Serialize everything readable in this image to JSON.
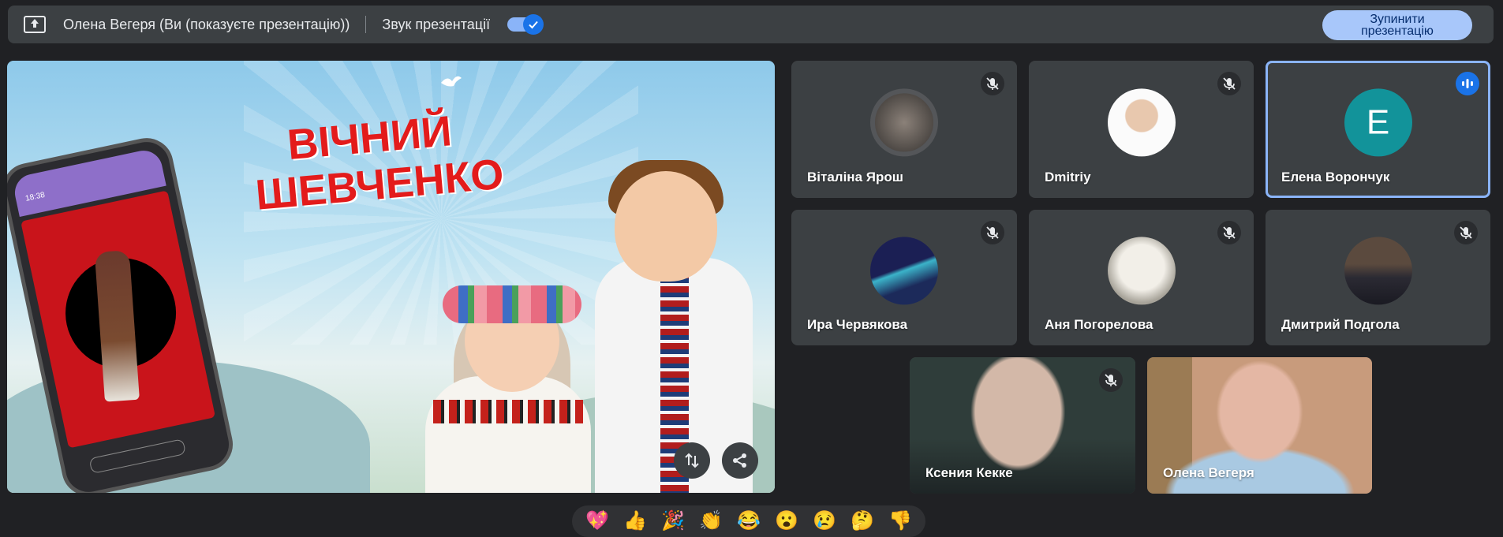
{
  "topbar": {
    "presenter_name": "Олена Вегеря (Ви (показуєте презентацію))",
    "sound_label": "Звук презентації",
    "sound_enabled": true,
    "stop_button": "Зупинити\nпрезентацію"
  },
  "slide": {
    "title_line1": "ВІЧНИЙ",
    "title_line2": "ШЕВЧЕНКО",
    "phone_time": "18:38"
  },
  "participants": [
    {
      "name": "Віталіна Ярош",
      "muted": true,
      "avatar": "photo"
    },
    {
      "name": "Dmitriy",
      "muted": true,
      "avatar": "photo"
    },
    {
      "name": "Елена Ворончук",
      "muted": false,
      "speaking": true,
      "avatar_letter": "Е",
      "avatar_color": "#12939a"
    },
    {
      "name": "Ира Червякова",
      "muted": true,
      "avatar": "photo"
    },
    {
      "name": "Аня Погорелова",
      "muted": true,
      "avatar": "photo"
    },
    {
      "name": "Дмитрий Подгола",
      "muted": true,
      "avatar": "photo"
    },
    {
      "name": "Ксения Кекке",
      "muted": true,
      "video": true
    },
    {
      "name": "Олена Вегеря",
      "muted": false,
      "video": true
    }
  ],
  "reactions": [
    "💖",
    "👍",
    "🎉",
    "👏",
    "😂",
    "😮",
    "😢",
    "🤔",
    "👎"
  ],
  "colors": {
    "background": "#202124",
    "tile": "#3c4043",
    "accent": "#8ab4f8",
    "stop_button": "#a8c7fa",
    "speaking": "#1a73e8"
  }
}
